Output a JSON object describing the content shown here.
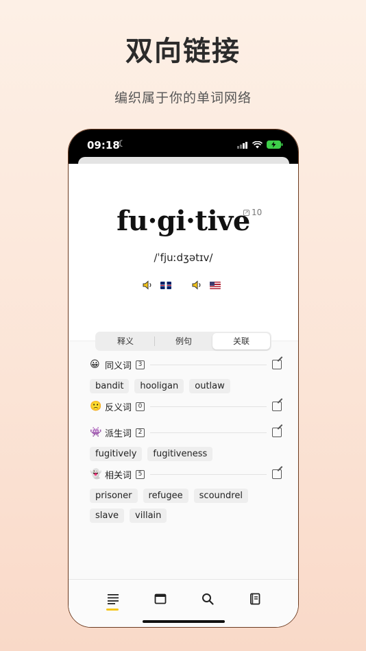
{
  "promo": {
    "headline": "双向链接",
    "subline": "编织属于你的单词网络"
  },
  "status_bar": {
    "time": "09:18",
    "moon": "☾"
  },
  "word": {
    "text": "fu·gi·tive",
    "lookup_count": "10",
    "phonetic": "/ˈfjuːdʒətɪv/",
    "audio": [
      {
        "region": "UK",
        "flag": "uk-flag-icon"
      },
      {
        "region": "US",
        "flag": "us-flag-icon"
      }
    ]
  },
  "segment": {
    "tabs": [
      "释义",
      "例句",
      "关联"
    ],
    "active": "关联"
  },
  "relations": [
    {
      "emoji": "😀",
      "label": "同义词",
      "count": "3",
      "items": [
        "bandit",
        "hooligan",
        "outlaw"
      ]
    },
    {
      "emoji": "🙁",
      "label": "反义词",
      "count": "0",
      "items": []
    },
    {
      "emoji": "👾",
      "label": "派生词",
      "count": "2",
      "items": [
        "fugitively",
        "fugitiveness"
      ]
    },
    {
      "emoji": "👻",
      "label": "相关词",
      "count": "5",
      "items": [
        "prisoner",
        "refugee",
        "scoundrel",
        "slave",
        "villain"
      ]
    }
  ],
  "tabbar": {
    "items": [
      "list-icon",
      "window-icon",
      "search-icon",
      "book-icon"
    ],
    "active_index": 0,
    "accent": "#f5c518"
  }
}
